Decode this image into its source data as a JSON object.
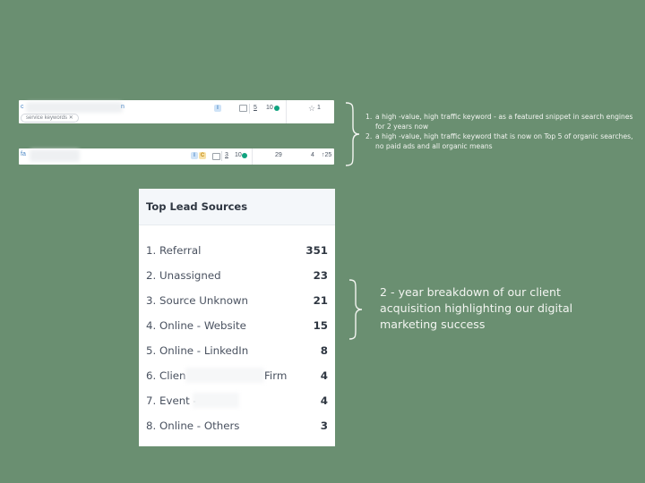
{
  "keyword_rows": [
    {
      "keyword_prefix": "c",
      "keyword_suffix": "n",
      "tag": "service keywords",
      "intent_badges": [
        "I"
      ],
      "serp_features": "5",
      "difficulty": "10",
      "position_change": "1",
      "status_color": "#10a37f"
    },
    {
      "keyword_prefix": "fa",
      "intent_badges": [
        "I",
        "C"
      ],
      "serp_features": "3",
      "difficulty": "10",
      "position": "29",
      "rank": "4",
      "change": "↑25",
      "status_color": "#10a37f"
    }
  ],
  "annotations": {
    "keywords_note": [
      {
        "num": "1.",
        "text": "a high -value, high traffic keyword - as a featured snippet in search engines for 2 years now"
      },
      {
        "num": "2.",
        "text": "a high -value, high traffic keyword that is now on Top 5 of organic searches, no paid ads and all organic means"
      }
    ],
    "lead_note": "2 - year breakdown of our client acquisition highlighting our digital marketing success"
  },
  "lead_sources": {
    "title": "Top Lead Sources",
    "items": [
      {
        "label": "1. Referral",
        "value": "351"
      },
      {
        "label": "2. Unassigned",
        "value": "23"
      },
      {
        "label": "3. Source Unknown",
        "value": "21"
      },
      {
        "label": "4. Online - Website",
        "value": "15"
      },
      {
        "label": "5. Online - LinkedIn",
        "value": "8"
      },
      {
        "label": "6. Clien",
        "label_tail": "Firm",
        "value": "4",
        "redacted": true
      },
      {
        "label": "7. Event -",
        "value": "4",
        "redacted": true
      },
      {
        "label": "8. Online - Others",
        "value": "3"
      }
    ]
  },
  "colors": {
    "background": "#6a8f71",
    "annotation_text": "#f3f5f1",
    "status_green": "#10a37f"
  }
}
